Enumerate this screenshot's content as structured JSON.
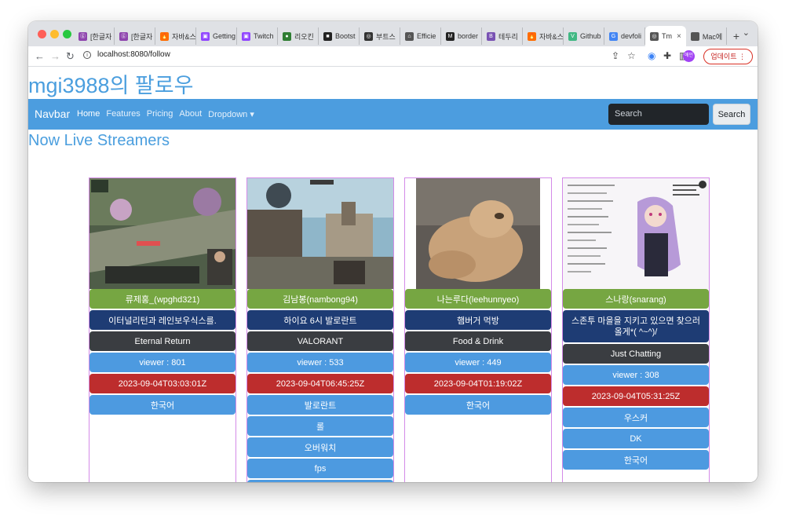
{
  "browser": {
    "tabs": [
      {
        "label": "[한글자",
        "fav": "ⓖ",
        "color": "#8e44ad"
      },
      {
        "label": "[한글자",
        "fav": "ⓖ",
        "color": "#8e44ad"
      },
      {
        "label": "자바&스",
        "fav": "🔥",
        "color": "#ff6d00"
      },
      {
        "label": "Getting",
        "fav": "▣",
        "color": "#9146ff"
      },
      {
        "label": "Twitch",
        "fav": "▣",
        "color": "#9146ff"
      },
      {
        "label": "리오킨",
        "fav": "●",
        "color": "#2e7d32"
      },
      {
        "label": "Bootst",
        "fav": "■",
        "color": "#222222"
      },
      {
        "label": "부트스",
        "fav": "◎",
        "color": "#333333"
      },
      {
        "label": "Efficie",
        "fav": "⌂",
        "color": "#555555"
      },
      {
        "label": "border",
        "fav": "M",
        "color": "#222222"
      },
      {
        "label": "테두리",
        "fav": "B",
        "color": "#7952b3"
      },
      {
        "label": "자바&스",
        "fav": "🔥",
        "color": "#ff6d00"
      },
      {
        "label": "Github",
        "fav": "V",
        "color": "#41b883"
      },
      {
        "label": "devfoli",
        "fav": "G",
        "color": "#4285f4"
      },
      {
        "label": "Tm",
        "fav": "◎",
        "color": "#555555"
      },
      {
        "label": "Mac에",
        "fav": "",
        "color": "#555555"
      }
    ],
    "active_tab_index": 14,
    "url": "localhost:8080/follow",
    "update_label": "업데이트",
    "avatar_text": "애인"
  },
  "page": {
    "title": "mgi3988의 팔로우",
    "section_title": "Now Live Streamers"
  },
  "navbar": {
    "brand": "Navbar",
    "links": [
      "Home",
      "Features",
      "Pricing",
      "About",
      "Dropdown ▾"
    ],
    "search_placeholder": "Search",
    "search_button": "Search"
  },
  "streamers": [
    {
      "name": "류제홍_(wpghd321)",
      "title": "이터널리턴과 레인보우식스를.",
      "game": "Eternal Return",
      "viewers": "viewer : 801",
      "started": "2023-09-04T03:03:01Z",
      "tags": [
        "한국어"
      ]
    },
    {
      "name": "김남봉(nambong94)",
      "title": "하이요 6시 발로란트",
      "game": "VALORANT",
      "viewers": "viewer : 533",
      "started": "2023-09-04T06:45:25Z",
      "tags": [
        "발로란트",
        "롤",
        "오버워치",
        "fps"
      ]
    },
    {
      "name": "나는루다(leehunnyeo)",
      "title": "햄버거 먹방",
      "game": "Food & Drink",
      "viewers": "viewer : 449",
      "started": "2023-09-04T01:19:02Z",
      "tags": [
        "한국어"
      ]
    },
    {
      "name": "스나랑(snarang)",
      "title": "스존투 마을을 지키고 있으면 찾으러 올게*( ^~^)/",
      "game": "Just Chatting",
      "viewers": "viewer : 308",
      "started": "2023-09-04T05:31:25Z",
      "tags": [
        "우스커",
        "DK",
        "한국어"
      ]
    }
  ]
}
